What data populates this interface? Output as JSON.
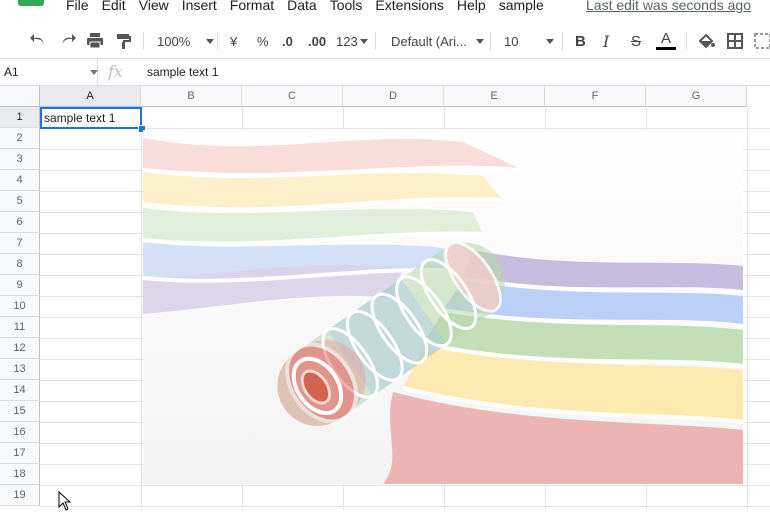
{
  "menu": {
    "items": [
      "File",
      "Edit",
      "View",
      "Insert",
      "Format",
      "Data",
      "Tools",
      "Extensions",
      "Help",
      "sample"
    ],
    "last_edit": "Last edit was seconds ago"
  },
  "toolbar": {
    "zoom": "100%",
    "currency": "¥",
    "percent": "%",
    "dec_decrease": ".0",
    "dec_increase": ".00",
    "number_format": "123",
    "font": "Default (Ari...",
    "font_size": "10",
    "bold": "B",
    "italic": "I",
    "strike": "S",
    "text_color_glyph": "A"
  },
  "formula_bar": {
    "name_box": "A1",
    "fx": "fx",
    "value": "sample text 1"
  },
  "grid": {
    "columns": [
      "A",
      "B",
      "C",
      "D",
      "E",
      "F",
      "G"
    ],
    "rows": [
      "1",
      "2",
      "3",
      "4",
      "5",
      "6",
      "7",
      "8",
      "9",
      "10",
      "11",
      "12",
      "13",
      "14",
      "15",
      "16",
      "17",
      "18",
      "19"
    ],
    "selected_cell": "A1",
    "cells": {
      "A1": "sample text 1"
    }
  },
  "image": {
    "description_icon": "rainbow-ribbon-roll-image",
    "ribbon_colors": [
      "#e06666",
      "#f6b26b",
      "#ffe599",
      "#b6d7a8",
      "#a4c2f4",
      "#b4a7d6"
    ]
  },
  "colors": {
    "selection": "#1a73e8",
    "header_bg": "#f8f9fa",
    "header_selected_bg": "#e8eaed",
    "logo": "#34a853"
  }
}
